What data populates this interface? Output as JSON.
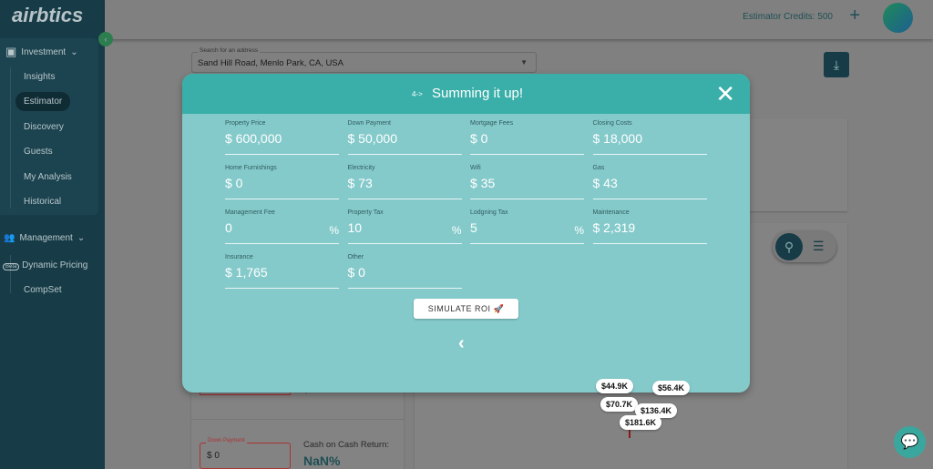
{
  "sidebar": {
    "logo": "airbtics",
    "sections": [
      {
        "label": "Investment",
        "items": [
          "Insights",
          "Estimator",
          "Discovery",
          "Guests",
          "My Analysis",
          "Historical"
        ]
      },
      {
        "label": "Management",
        "items": [
          "Dynamic Pricing",
          "CompSet"
        ],
        "badge": "Beta"
      }
    ],
    "active": "Estimator"
  },
  "header": {
    "credits": "Estimator Credits: 500"
  },
  "search": {
    "label": "Search for an address",
    "value": "Sand Hill Road, Menlo Park, CA, USA"
  },
  "background": {
    "down_payment_label": "Down Payment",
    "down_payment_value": "$ 0",
    "coc_label": "Cash on Cash Return:",
    "coc_value": "NaN%",
    "partial_value": "$0"
  },
  "map_markers": [
    "$44.9K",
    "$56.4K",
    "$70.7K",
    "$136.4K",
    "$181.6K"
  ],
  "modal": {
    "step": "4->",
    "title": "Summing it up!",
    "simulate": "SIMULATE ROI 🚀",
    "fields": [
      {
        "label": "Property Price",
        "value": "$ 600,000"
      },
      {
        "label": "Down Payment",
        "value": "$ 50,000"
      },
      {
        "label": "Mortgage Fees",
        "value": "$ 0"
      },
      {
        "label": "Closing Costs",
        "value": "$ 18,000"
      },
      {
        "label": "Home Furnishings",
        "value": "$ 0"
      },
      {
        "label": "Electricity",
        "value": "$ 73"
      },
      {
        "label": "Wifi",
        "value": "$ 35"
      },
      {
        "label": "Gas",
        "value": "$ 43"
      },
      {
        "label": "Management Fee",
        "value": "0",
        "unit": "%"
      },
      {
        "label": "Property Tax",
        "value": "10",
        "unit": "%"
      },
      {
        "label": "Lodgning Tax",
        "value": "5",
        "unit": "%"
      },
      {
        "label": "Maintenance",
        "value": "$ 2,319"
      },
      {
        "label": "Insurance",
        "value": "$ 1,765"
      },
      {
        "label": "Other",
        "value": "$ 0"
      }
    ]
  },
  "colors": {
    "teal": "#3aafa9",
    "modal_body": "#85cacb",
    "sidebar": "#173c47"
  }
}
